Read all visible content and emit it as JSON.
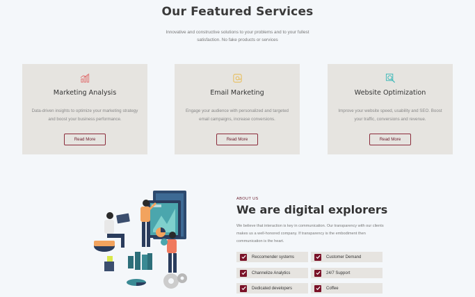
{
  "services": {
    "title": "Our Featured Services",
    "subtitle": "Innovative and constructive solutions to your problems and to your fullest satisfaction. No fake products or services",
    "cards": [
      {
        "title": "Marketing Analysis",
        "description": "Data-driven insights to optimize your marketing strategy and boost your business performance.",
        "button": "Read More",
        "icon": "chart-icon",
        "icon_color": "#e07070"
      },
      {
        "title": "Email Marketing",
        "description": "Engage your audience with personalized and targeted email campaigns, increase conversions.",
        "button": "Read More",
        "icon": "mail-icon",
        "icon_color": "#e8b84a"
      },
      {
        "title": "Website Optimization",
        "description": "Improve your website speed, usability and SEO. Boost your traffic, conversions and revenue.",
        "button": "Read More",
        "icon": "search-web-icon",
        "icon_color": "#3ab8b8"
      }
    ]
  },
  "about": {
    "label": "ABOUT US",
    "title": "We are digital explorers",
    "text": "We believe that interaction is key in communication. Our transparency with our clients makes us a well-honored company. If transparency is the embodiment then communication is the heart.",
    "features": [
      "Reccomender systems",
      "Customer Demand",
      "Channelize Analytics",
      "24/7 Support",
      "Dedicated developers",
      "Coffee"
    ]
  },
  "colors": {
    "accent": "#7a1228",
    "card_bg": "#e6e4e0",
    "page_bg": "#f4f7fa"
  }
}
